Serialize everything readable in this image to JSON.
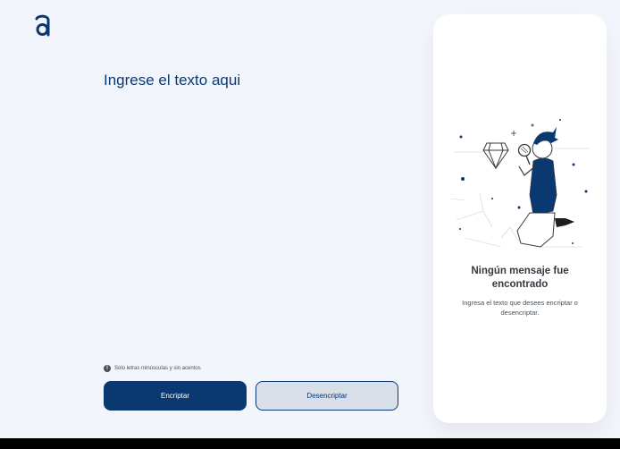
{
  "editor": {
    "placeholder": "Ingrese el texto aqui"
  },
  "hint": {
    "icon": "info-icon",
    "icon_glyph": "!",
    "text": "Solo letras minúsculas y sin acentos"
  },
  "buttons": {
    "encrypt_label": "Encriptar",
    "decrypt_label": "Desencriptar"
  },
  "output": {
    "title": "Ningún mensaje fue encontrado",
    "description": "Ingresa el texto que desees encriptar o desencriptar."
  },
  "colors": {
    "primary": "#0a3871",
    "background": "#f3f5fc",
    "secondary_button": "#d8dfe8"
  }
}
